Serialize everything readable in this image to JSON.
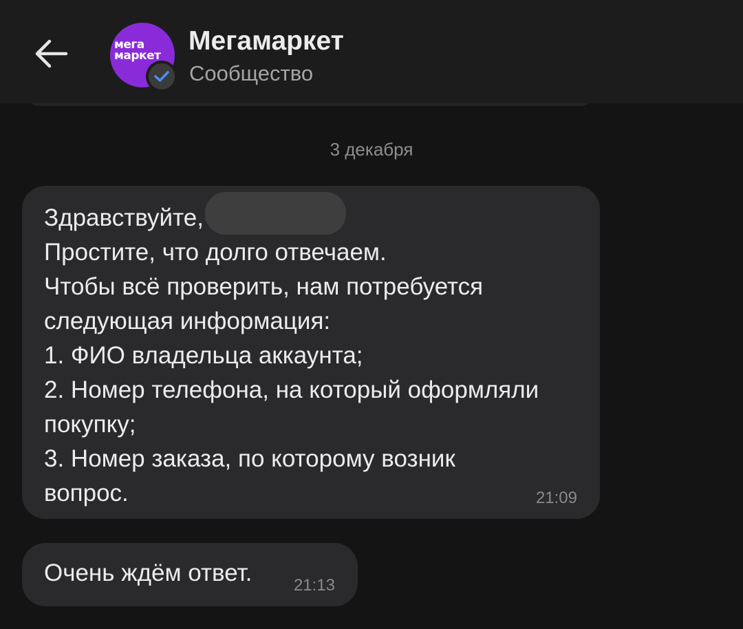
{
  "header": {
    "back_icon": "arrow-left-icon",
    "avatar_logo_line1": "мега",
    "avatar_logo_line2": "маркет",
    "avatar_color": "#8a2bd9",
    "verified_icon": "check-badge-icon",
    "verified_color": "#4d8ef0",
    "title": "Мегамаркет",
    "subtitle": "Сообщество"
  },
  "date_separator": "3 декабря",
  "messages": [
    {
      "lines_before": "Здравствуйте,",
      "lines_after": "Простите, что долго отвечаем.\nЧтобы всё проверить, нам потребуется\nследующая информация:\n1. ФИО владельца аккаунта;\n2. Номер телефона, на который оформляли\nпокупку;\n3. Номер заказа, по которому возник\nвопрос.",
      "time": "21:09"
    },
    {
      "text": "Очень ждём ответ.",
      "time": "21:13"
    }
  ]
}
